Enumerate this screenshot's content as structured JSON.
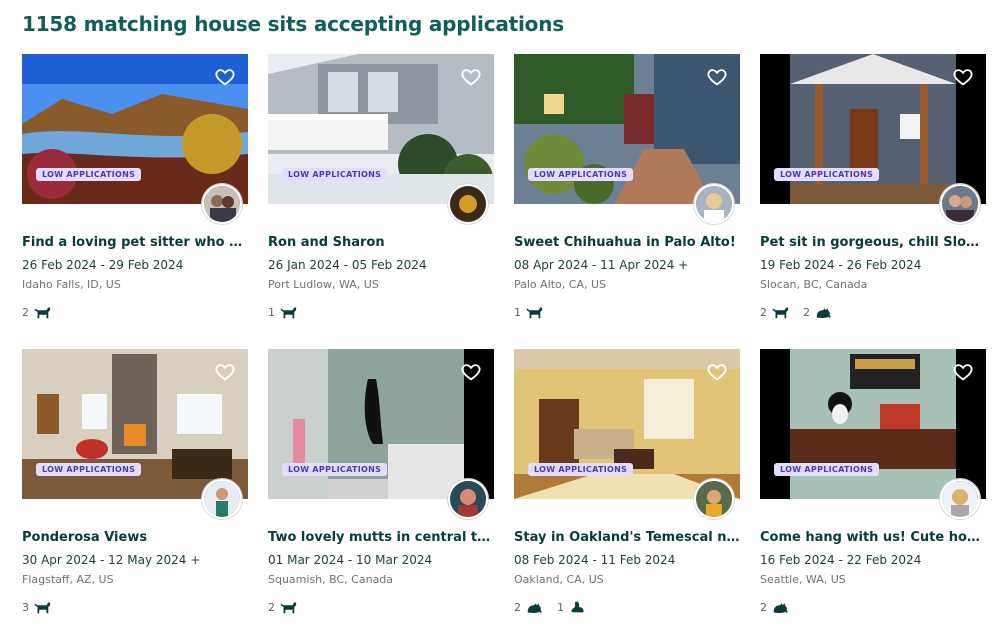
{
  "header": {
    "title": "1158 matching house sits accepting applications"
  },
  "colors": {
    "brand": "#105e5a",
    "badge_bg": "#e3dcff",
    "badge_text": "#4b3bb2",
    "pet_icon": "#0b3b3b"
  },
  "badge_label": "LOW APPLICATIONS",
  "listings": [
    {
      "title": "Find a loving pet sitter who wan...",
      "dates": "26 Feb 2024 - 29 Feb 2024",
      "location": "Idaho Falls, ID, US",
      "pets": [
        {
          "count": "2",
          "icon": "dog-icon"
        }
      ]
    },
    {
      "title": "Ron and Sharon",
      "dates": "26 Jan 2024 - 05 Feb 2024",
      "location": "Port Ludlow, WA, US",
      "pets": [
        {
          "count": "1",
          "icon": "dog-icon"
        }
      ]
    },
    {
      "title": "Sweet Chihuahua in Palo Alto!",
      "dates": "08 Apr 2024 - 11 Apr 2024 +",
      "location": "Palo Alto, CA, US",
      "pets": [
        {
          "count": "1",
          "icon": "dog-icon"
        }
      ]
    },
    {
      "title": "Pet sit in gorgeous, chill Slocan, ...",
      "dates": "19 Feb 2024 - 26 Feb 2024",
      "location": "Slocan, BC, Canada",
      "pets": [
        {
          "count": "2",
          "icon": "dog-icon"
        },
        {
          "count": "2",
          "icon": "cat-icon"
        }
      ]
    },
    {
      "title": "Ponderosa Views",
      "dates": "30 Apr 2024 - 12 May 2024 +",
      "location": "Flagstaff, AZ, US",
      "pets": [
        {
          "count": "3",
          "icon": "dog-icon"
        }
      ]
    },
    {
      "title": "Two lovely mutts in central tow...",
      "dates": "01 Mar 2024 - 10 Mar 2024",
      "location": "Squamish, BC, Canada",
      "pets": [
        {
          "count": "2",
          "icon": "dog-icon"
        }
      ]
    },
    {
      "title": "Stay in Oakland's Temescal nei...",
      "dates": "08 Feb 2024 - 11 Feb 2024",
      "location": "Oakland, CA, US",
      "pets": [
        {
          "count": "2",
          "icon": "cat-icon"
        },
        {
          "count": "1",
          "icon": "rabbit-icon"
        }
      ]
    },
    {
      "title": "Come hang with us! Cute hous...",
      "dates": "16 Feb 2024 - 22 Feb 2024",
      "location": "Seattle, WA, US",
      "pets": [
        {
          "count": "2",
          "icon": "cat-icon"
        }
      ]
    }
  ]
}
